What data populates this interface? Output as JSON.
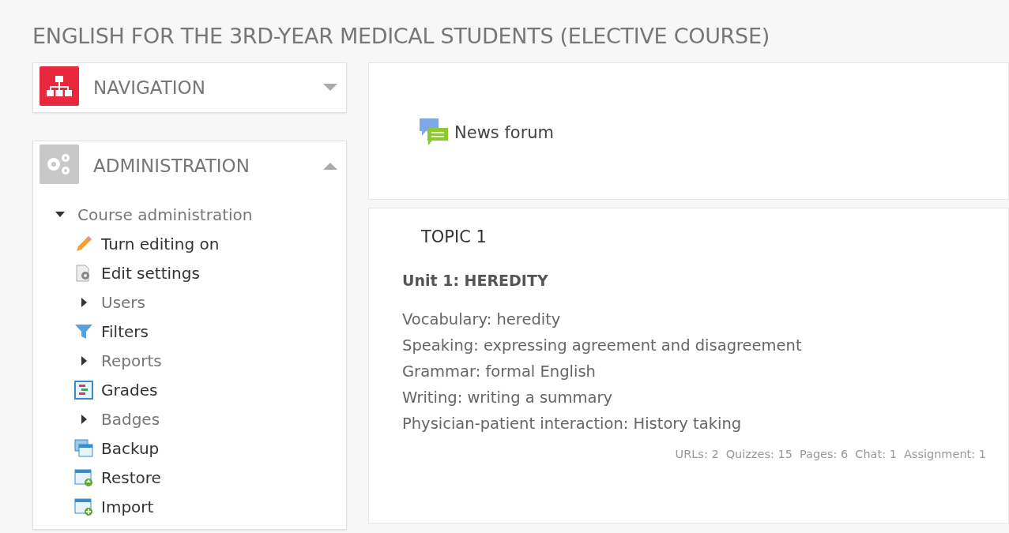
{
  "page_title": "ENGLISH FOR THE 3RD-YEAR MEDICAL STUDENTS (ELECTIVE COURSE)",
  "blocks": [
    {
      "title": "NAVIGATION",
      "expanded": false
    },
    {
      "title": "ADMINISTRATION",
      "expanded": true,
      "tree": [
        {
          "label": "Course administration",
          "kind": "branch",
          "expanded": true,
          "children": [
            {
              "label": "Turn editing on",
              "kind": "link"
            },
            {
              "label": "Edit settings",
              "kind": "link"
            },
            {
              "label": "Users",
              "kind": "branch",
              "expanded": false
            },
            {
              "label": "Filters",
              "kind": "link"
            },
            {
              "label": "Reports",
              "kind": "branch",
              "expanded": false
            },
            {
              "label": "Grades",
              "kind": "link"
            },
            {
              "label": "Badges",
              "kind": "branch",
              "expanded": false
            },
            {
              "label": "Backup",
              "kind": "link"
            },
            {
              "label": "Restore",
              "kind": "link"
            },
            {
              "label": "Import",
              "kind": "link"
            }
          ]
        }
      ]
    }
  ],
  "general_section": {
    "activities": [
      {
        "label": "News forum"
      }
    ]
  },
  "topic": {
    "title": "TOPIC 1",
    "heading": "Unit 1: HEREDITY",
    "lines": [
      "Vocabulary: heredity",
      "Speaking: expressing agreement and disagreement",
      "Grammar: formal English",
      "Writing: writing a summary",
      "Physician-patient interaction: History taking"
    ],
    "activity_counts": [
      "URLs: 2",
      "Quizzes: 15",
      "Pages: 6",
      "Chat: 1",
      "Assignment: 1"
    ]
  }
}
